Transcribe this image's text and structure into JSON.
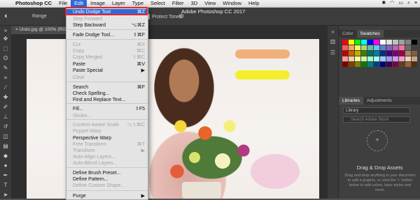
{
  "mac_menubar": {
    "apple": "",
    "app_name": "Photoshop CC",
    "menus": [
      "File",
      "Edit",
      "Image",
      "Layer",
      "Type",
      "Select",
      "Filter",
      "3D",
      "View",
      "Window",
      "Help"
    ]
  },
  "options_bar": {
    "range_label": "Range",
    "protect_tones": "Protect Tones",
    "app_title": "Adobe Photoshop CC 2017"
  },
  "document": {
    "tab_label": "Undo.jpg @ 100% (RGB"
  },
  "edit_menu": {
    "items": [
      {
        "label": "Undo Dodge Tool",
        "shortcut": "⌘Z",
        "state": "selected"
      },
      {
        "label": "Step Forward",
        "shortcut": "",
        "state": "disabled"
      },
      {
        "label": "Step Backward",
        "shortcut": "⌥⌘Z",
        "state": "enabled"
      },
      {
        "label": "Fade Dodge Tool...",
        "shortcut": "⇧⌘F",
        "state": "enabled"
      },
      {
        "label": "Cut",
        "shortcut": "⌘X",
        "state": "disabled"
      },
      {
        "label": "Copy",
        "shortcut": "⌘C",
        "state": "disabled"
      },
      {
        "label": "Copy Merged",
        "shortcut": "⇧⌘C",
        "state": "disabled"
      },
      {
        "label": "Paste",
        "shortcut": "⌘V",
        "state": "enabled"
      },
      {
        "label": "Paste Special",
        "shortcut": "▶",
        "state": "enabled"
      },
      {
        "label": "Clear",
        "shortcut": "",
        "state": "disabled"
      },
      {
        "label": "Search",
        "shortcut": "⌘F",
        "state": "enabled"
      },
      {
        "label": "Check Spelling...",
        "shortcut": "",
        "state": "enabled"
      },
      {
        "label": "Find and Replace Text...",
        "shortcut": "",
        "state": "enabled"
      },
      {
        "label": "Fill...",
        "shortcut": "⇧F5",
        "state": "enabled"
      },
      {
        "label": "Stroke...",
        "shortcut": "",
        "state": "disabled"
      },
      {
        "label": "Content-Aware Scale",
        "shortcut": "⌥⇧⌘C",
        "state": "disabled"
      },
      {
        "label": "Puppet Warp",
        "shortcut": "",
        "state": "disabled"
      },
      {
        "label": "Perspective Warp",
        "shortcut": "",
        "state": "enabled"
      },
      {
        "label": "Free Transform",
        "shortcut": "⌘T",
        "state": "disabled"
      },
      {
        "label": "Transform",
        "shortcut": "▶",
        "state": "disabled"
      },
      {
        "label": "Auto-Align Layers...",
        "shortcut": "",
        "state": "disabled"
      },
      {
        "label": "Auto-Blend Layers...",
        "shortcut": "",
        "state": "disabled"
      },
      {
        "label": "Define Brush Preset...",
        "shortcut": "",
        "state": "enabled"
      },
      {
        "label": "Define Pattern...",
        "shortcut": "",
        "state": "enabled"
      },
      {
        "label": "Define Custom Shape...",
        "shortcut": "",
        "state": "disabled"
      },
      {
        "label": "Purge",
        "shortcut": "▶",
        "state": "enabled"
      }
    ]
  },
  "panels": {
    "color_tab": "Color",
    "swatches_tab": "Swatches",
    "libraries_tab": "Libraries",
    "adjustments_tab": "Adjustments",
    "library_select": "Library",
    "search_placeholder": "Search Adobe Stock",
    "drop_title": "Drag & Drop Assets",
    "drop_desc": "Drag and drop anything in your document to add a graphic, or click the '+' button below to add colors, layer styles and more."
  },
  "colors": {
    "selection": "#2f6bd6",
    "highlight_border": "#e3272e",
    "menu_bg": "#e4e4e4",
    "swatches": [
      "#ff0000",
      "#ffff00",
      "#00ff00",
      "#00ffff",
      "#0000ff",
      "#ff00ff",
      "#ffffff",
      "#e0e0e0",
      "#c0c0c0",
      "#a0a0a0",
      "#808080",
      "#000000",
      "#f06060",
      "#f7a860",
      "#fff460",
      "#a6d870",
      "#60c0a0",
      "#60c8f0",
      "#6080d0",
      "#8860c0",
      "#c060b0",
      "#f070a0",
      "#6a6a6a",
      "#404040",
      "#c00000",
      "#d06000",
      "#c0b000",
      "#408000",
      "#007060",
      "#0080a0",
      "#003080",
      "#400080",
      "#800070",
      "#a00040",
      "#b08060",
      "#806040",
      "#ff9999",
      "#ffcc99",
      "#ffff99",
      "#ccff99",
      "#99ffcc",
      "#99ffff",
      "#99ccff",
      "#9999ff",
      "#cc99ff",
      "#ff99cc",
      "#e8d4b8",
      "#c8a880",
      "#800000",
      "#804000",
      "#808000",
      "#008000",
      "#008080",
      "#004080",
      "#000080",
      "#400040",
      "#800040",
      "#604020",
      "#a06030",
      "#503010"
    ]
  }
}
